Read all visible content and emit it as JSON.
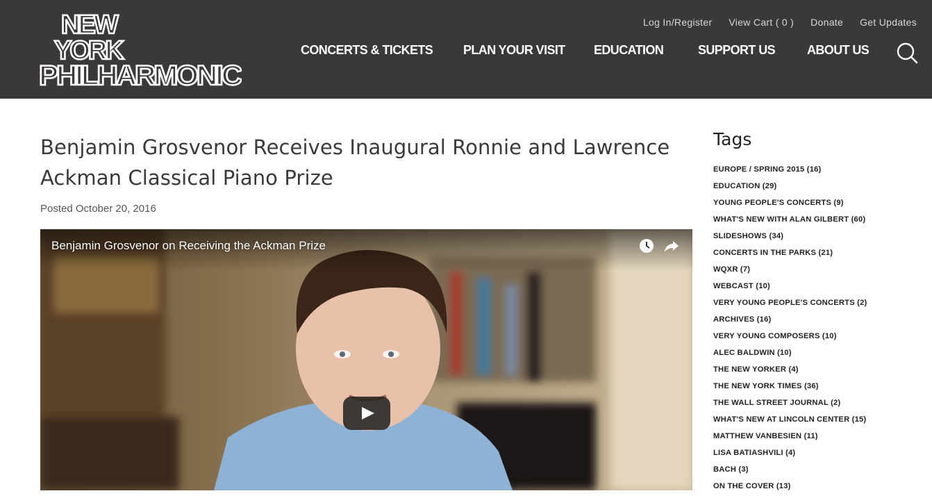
{
  "header": {
    "logo_lines": [
      "NEW",
      "YORK",
      "PHILHARMONIC"
    ],
    "utility_links": [
      "Log In/Register",
      "View Cart ( 0 )",
      "Donate",
      "Get Updates"
    ],
    "nav": [
      "CONCERTS & TICKETS",
      "PLAN YOUR VISIT",
      "EDUCATION",
      "SUPPORT US",
      "ABOUT US"
    ],
    "search_icon": "search-icon"
  },
  "article": {
    "title": "Benjamin Grosvenor Receives Inaugural Ronnie and Lawrence Ackman Classical Piano Prize",
    "posted": "Posted October 20, 2016"
  },
  "video": {
    "title": "Benjamin Grosvenor on Receiving the Ackman Prize",
    "icons": [
      "watch-later-icon",
      "share-icon",
      "play-icon"
    ]
  },
  "sidebar": {
    "title": "Tags",
    "tags": [
      "EUROPE / SPRING 2015 (16)",
      "EDUCATION (29)",
      "YOUNG PEOPLE'S CONCERTS (9)",
      "WHAT'S NEW WITH ALAN GILBERT (60)",
      "SLIDESHOWS (34)",
      "CONCERTS IN THE PARKS (21)",
      "WQXR (7)",
      "WEBCAST (10)",
      "VERY YOUNG PEOPLE'S CONCERTS (2)",
      "ARCHIVES (16)",
      "VERY YOUNG COMPOSERS (10)",
      "ALEC BALDWIN (10)",
      "THE NEW YORKER (4)",
      "THE NEW YORK TIMES (36)",
      "THE WALL STREET JOURNAL (2)",
      "WHAT'S NEW AT LINCOLN CENTER (15)",
      "MATTHEW VANBESIEN (11)",
      "LISA BATIASHVILI (4)",
      "BACH (3)",
      "ON THE COVER (13)"
    ]
  },
  "colors": {
    "header_bg": "#3a3839",
    "text": "#333333"
  }
}
